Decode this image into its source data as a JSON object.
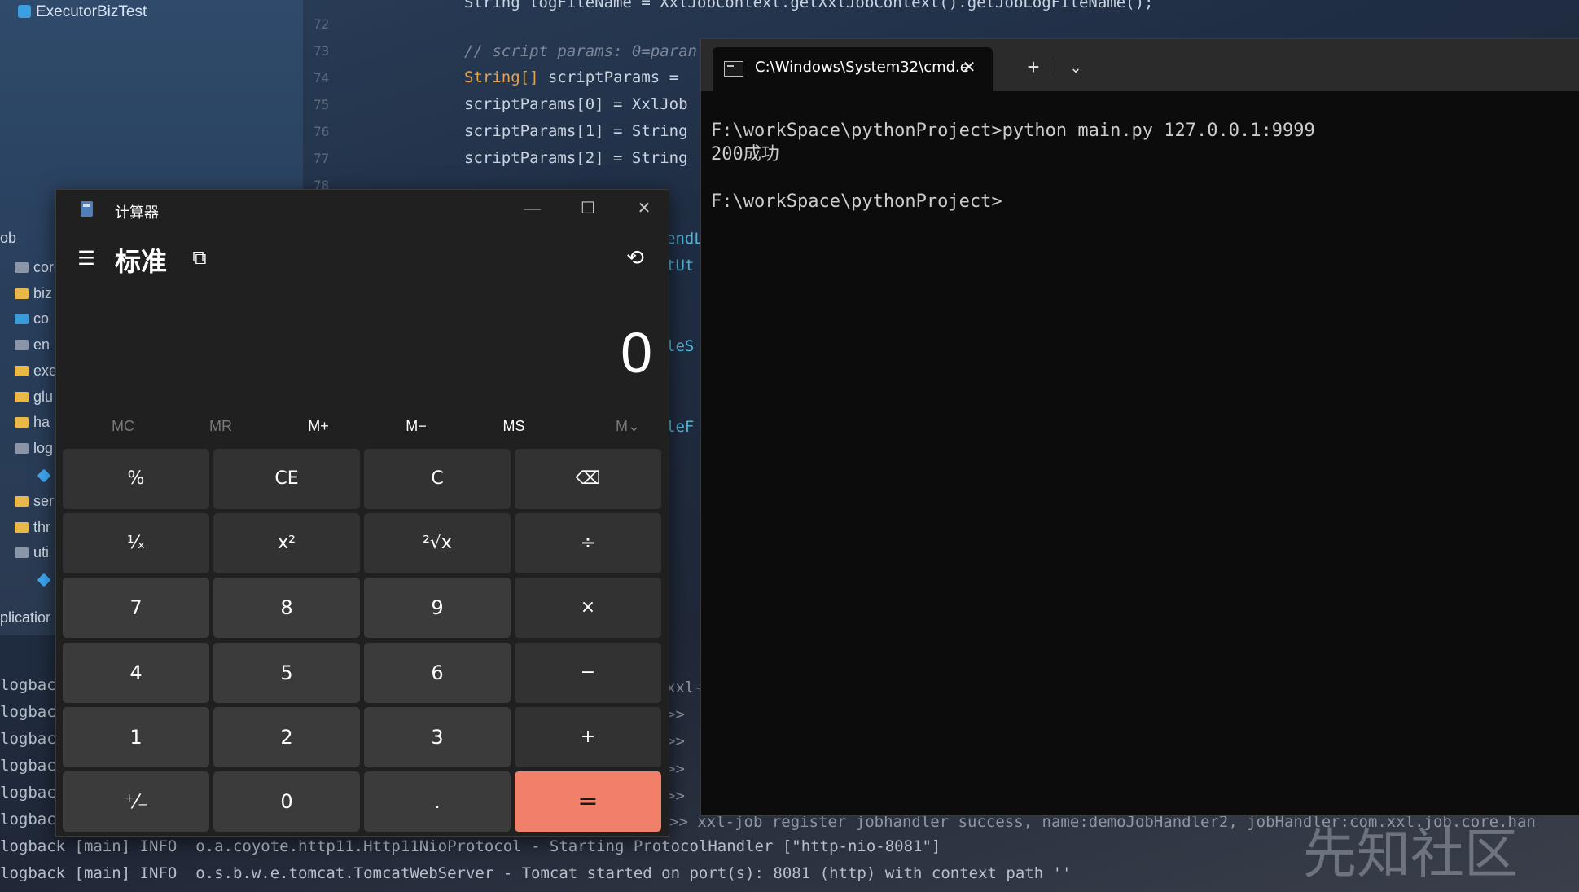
{
  "ide": {
    "title": "ExecutorBizTest",
    "tree": [
      {
        "label": "ob",
        "icon": "none"
      },
      {
        "label": "core",
        "icon": "module"
      },
      {
        "label": "biz",
        "icon": "folder"
      },
      {
        "label": "co",
        "icon": "blue-folder"
      },
      {
        "label": "en",
        "icon": "gray-folder"
      },
      {
        "label": "exe",
        "icon": "folder"
      },
      {
        "label": "glu",
        "icon": "folder"
      },
      {
        "label": "ha",
        "icon": "folder"
      },
      {
        "label": "log",
        "icon": "gray-folder"
      },
      {
        "label": "",
        "icon": "cube"
      },
      {
        "label": "ser",
        "icon": "folder"
      },
      {
        "label": "thr",
        "icon": "folder"
      },
      {
        "label": "uti",
        "icon": "gray-folder"
      },
      {
        "label": "",
        "icon": "cube"
      }
    ],
    "app_label": "plicatior",
    "line_numbers": [
      "72",
      "73",
      "74",
      "75",
      "76",
      "77",
      "78"
    ],
    "code": {
      "l0": "String logFileName = XxlJobContext.getXxlJobContext().getJobLogFileName();",
      "l1": "// script params: 0=paran",
      "l2a": "String[]",
      "l2b": " scriptParams = ",
      "l3": "scriptParams[0] = XxlJob",
      "l4": "scriptParams[1] = String",
      "l5": "scriptParams[2] = String"
    },
    "fragments": [
      "endL",
      "tUt",
      "leS",
      "leF",
      "xxl-",
      ">>",
      ">>",
      ">>",
      ">>"
    ],
    "logs": [
      "logbac",
      "logbac",
      "logbac",
      "logbac",
      "logbac",
      "logbac",
      "logback [main] INFO  o.a.coyote.http11.Http11NioProtocol - Starting ProtocolHandler [\"http-nio-8081\"]",
      "logback [main] INFO  o.s.b.w.e.tomcat.TomcatWebServer - Tomcat started on port(s): 8081 (http) with context path ''"
    ],
    "register_line": ">> xxl-job register jobhandler success, name:demoJobHandler2, jobHandler:com.xxl.job.core.han",
    "watermark": "先知社区"
  },
  "calculator": {
    "title": "计算器",
    "mode": "标准",
    "display": "0",
    "window_controls": {
      "minimize": "—",
      "maximize": "☐",
      "close": "✕"
    },
    "memory": [
      {
        "label": "MC",
        "enabled": false
      },
      {
        "label": "MR",
        "enabled": false
      },
      {
        "label": "M+",
        "enabled": true
      },
      {
        "label": "M−",
        "enabled": true
      },
      {
        "label": "MS",
        "enabled": true
      },
      {
        "label": "M⌄",
        "enabled": false
      }
    ],
    "keys": [
      [
        "%",
        "CE",
        "C",
        "⌫"
      ],
      [
        "¹⁄ₓ",
        "x²",
        "²√x",
        "÷"
      ],
      [
        "7",
        "8",
        "9",
        "×"
      ],
      [
        "4",
        "5",
        "6",
        "−"
      ],
      [
        "1",
        "2",
        "3",
        "+"
      ],
      [
        "⁺⁄₋",
        "0",
        ".",
        "="
      ]
    ]
  },
  "terminal": {
    "tab_title": "C:\\Windows\\System32\\cmd.e",
    "close_glyph": "✕",
    "new_tab_glyph": "+",
    "dropdown_glyph": "⌄",
    "lines": [
      "F:\\workSpace\\pythonProject>python main.py 127.0.0.1:9999",
      "200成功",
      "",
      "F:\\workSpace\\pythonProject>"
    ]
  }
}
